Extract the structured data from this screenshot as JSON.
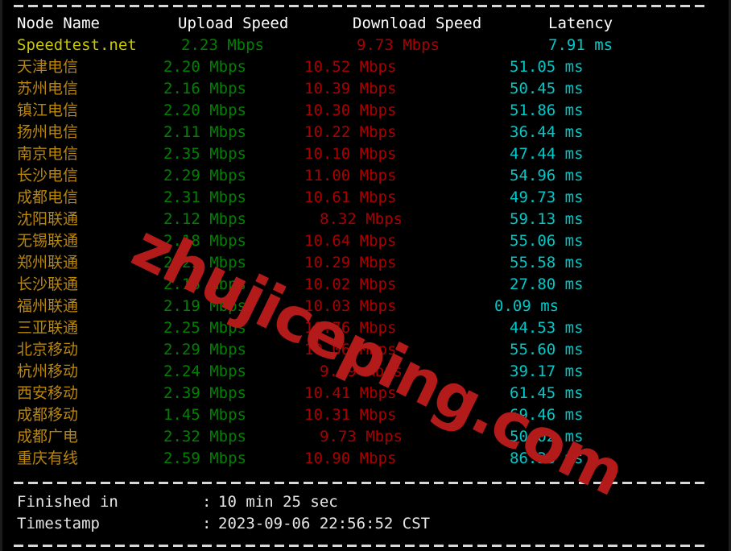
{
  "terminal": {
    "background_color": "#000000",
    "rule_char": "-"
  },
  "colors": {
    "header": "#ffffff",
    "node_name": "#b8860b",
    "brand_row": "#c8c800",
    "upload": "#008000",
    "download": "#a80000",
    "latency": "#00c8c8",
    "plain_text": "#e6e6e6",
    "watermark": "#b31a1a"
  },
  "table": {
    "headers": {
      "node": "Node Name",
      "upload": "Upload Speed",
      "download": "Download Speed",
      "latency": "Latency"
    },
    "reference_row": {
      "node": "Speedtest.net",
      "upload": "2.23 Mbps",
      "download": "9.73 Mbps",
      "latency": "7.91 ms"
    },
    "rows": [
      {
        "node": "天津电信",
        "upload": "2.20 Mbps",
        "download": "10.52 Mbps",
        "latency": "51.05 ms"
      },
      {
        "node": "苏州电信",
        "upload": "2.16 Mbps",
        "download": "10.39 Mbps",
        "latency": "50.45 ms"
      },
      {
        "node": "镇江电信",
        "upload": "2.20 Mbps",
        "download": "10.30 Mbps",
        "latency": "51.86 ms"
      },
      {
        "node": "扬州电信",
        "upload": "2.11 Mbps",
        "download": "10.22 Mbps",
        "latency": "36.44 ms"
      },
      {
        "node": "南京电信",
        "upload": "2.35 Mbps",
        "download": "10.10 Mbps",
        "latency": "47.44 ms"
      },
      {
        "node": "长沙电信",
        "upload": "2.29 Mbps",
        "download": "11.00 Mbps",
        "latency": "54.96 ms"
      },
      {
        "node": "成都电信",
        "upload": "2.31 Mbps",
        "download": "10.61 Mbps",
        "latency": "49.73 ms"
      },
      {
        "node": "沈阳联通",
        "upload": "2.12 Mbps",
        "download": "8.32 Mbps",
        "latency": "59.13 ms"
      },
      {
        "node": "无锡联通",
        "upload": "2.18 Mbps",
        "download": "10.64 Mbps",
        "latency": "55.06 ms"
      },
      {
        "node": "郑州联通",
        "upload": "2.29 Mbps",
        "download": "10.29 Mbps",
        "latency": "55.58 ms"
      },
      {
        "node": "长沙联通",
        "upload": "2.16 Mbps",
        "download": "10.02 Mbps",
        "latency": "27.80 ms"
      },
      {
        "node": "福州联通",
        "upload": "2.19 Mbps",
        "download": "10.03 Mbps",
        "latency": "0.09 ms"
      },
      {
        "node": "三亚联通",
        "upload": "2.25 Mbps",
        "download": "10.76 Mbps",
        "latency": "44.53 ms"
      },
      {
        "node": "北京移动",
        "upload": "2.29 Mbps",
        "download": "10.06 Mbps",
        "latency": "55.60 ms"
      },
      {
        "node": "杭州移动",
        "upload": "2.24 Mbps",
        "download": "9.99 Mbps",
        "latency": "39.17 ms"
      },
      {
        "node": "西安移动",
        "upload": "2.39 Mbps",
        "download": "10.41 Mbps",
        "latency": "61.45 ms"
      },
      {
        "node": "成都移动",
        "upload": "1.45 Mbps",
        "download": "10.31 Mbps",
        "latency": "69.46 ms"
      },
      {
        "node": "成都广电",
        "upload": "2.32 Mbps",
        "download": "9.73 Mbps",
        "latency": "50.02 ms"
      },
      {
        "node": "重庆有线",
        "upload": "2.59 Mbps",
        "download": "10.90 Mbps",
        "latency": "86.33 ms"
      }
    ]
  },
  "footer": {
    "finished_label": "Finished in",
    "finished_colon": ":",
    "finished_value": "10 min 25 sec",
    "timestamp_label": "Timestamp",
    "timestamp_colon": ":",
    "timestamp_value": "2023-09-06 22:56:52 CST"
  },
  "watermark": {
    "text": "zhujiceping.com"
  }
}
